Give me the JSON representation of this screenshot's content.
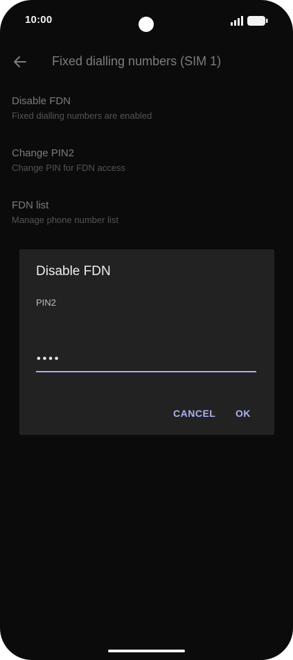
{
  "status_bar": {
    "time": "10:00",
    "icons": [
      "signal-icon",
      "battery-icon"
    ]
  },
  "app_bar": {
    "back_icon": "arrow-back-icon",
    "title": "Fixed dialling numbers (SIM 1)"
  },
  "preferences": [
    {
      "title": "Disable FDN",
      "summary": "Fixed dialling numbers are enabled"
    },
    {
      "title": "Change PIN2",
      "summary": "Change PIN for FDN access"
    },
    {
      "title": "FDN list",
      "summary": "Manage phone number list"
    }
  ],
  "dialog": {
    "title": "Disable FDN",
    "field_label": "PIN2",
    "pin_value": "••••",
    "cancel_label": "CANCEL",
    "ok_label": "OK"
  },
  "colors": {
    "background": "#0b0b0b",
    "dialog": "#222222",
    "accent": "#aab2f5"
  }
}
